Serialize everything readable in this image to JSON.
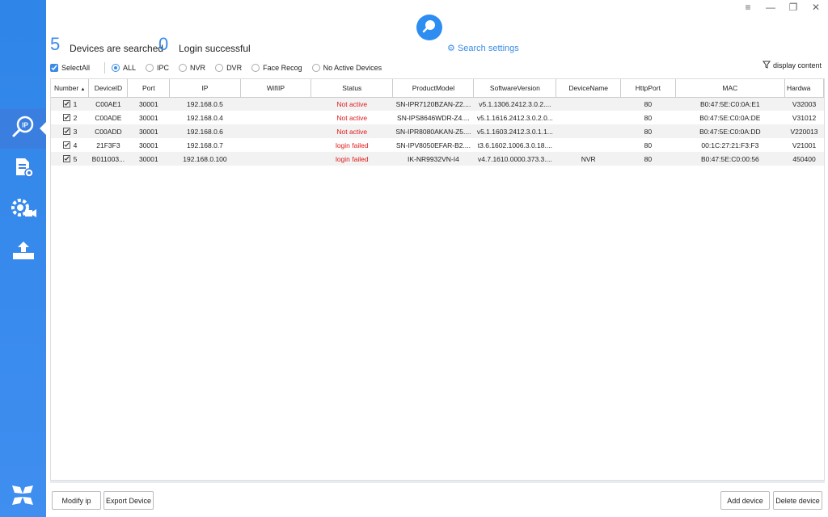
{
  "window": {
    "menu": "≡",
    "minimize": "—",
    "restore": "❐",
    "close": "✕"
  },
  "stats": {
    "searched_count": "5",
    "searched_label": "Devices are searched",
    "login_count": "0",
    "login_label": "Login successful"
  },
  "search": {
    "settings_label": "Search settings"
  },
  "filters": {
    "select_all": "SelectAll",
    "options": [
      "ALL",
      "IPC",
      "NVR",
      "DVR",
      "Face Recog",
      "No Active Devices"
    ],
    "selected": "ALL",
    "display_content": "display content"
  },
  "table": {
    "columns": [
      "Number",
      "DeviceID",
      "Port",
      "IP",
      "WifiIP",
      "Status",
      "ProductModel",
      "SoftwareVersion",
      "DeviceName",
      "HttpPort",
      "MAC",
      "Hardwa"
    ],
    "rows": [
      {
        "number": "1",
        "device_id": "C00AE1",
        "port": "30001",
        "ip": "192.168.0.5",
        "wifi_ip": "",
        "status": "Not active",
        "product_model": "SN-IPR7120BZAN-Z2....",
        "software_version": "v5.1.1306.2412.3.0.2....",
        "device_name": "",
        "http_port": "80",
        "mac": "B0:47:5E:C0:0A:E1",
        "hardware": "V32003"
      },
      {
        "number": "2",
        "device_id": "C00ADE",
        "port": "30001",
        "ip": "192.168.0.4",
        "wifi_ip": "",
        "status": "Not active",
        "product_model": "SN-IPS8646WDR-Z4....",
        "software_version": "v5.1.1616.2412.3.0.2.0...",
        "device_name": "",
        "http_port": "80",
        "mac": "B0:47:5E:C0:0A:DE",
        "hardware": "V31012"
      },
      {
        "number": "3",
        "device_id": "C00ADD",
        "port": "30001",
        "ip": "192.168.0.6",
        "wifi_ip": "",
        "status": "Not active",
        "product_model": "SN-IPR8080AKAN-Z5....",
        "software_version": "v5.1.1603.2412.3.0.1.1...",
        "device_name": "",
        "http_port": "80",
        "mac": "B0:47:5E:C0:0A:DD",
        "hardware": "V220013"
      },
      {
        "number": "4",
        "device_id": "21F3F3",
        "port": "30001",
        "ip": "192.168.0.7",
        "wifi_ip": "",
        "status": "login failed",
        "product_model": "SN-IPV8050EFAR-B2....",
        "software_version": "t3.6.1602.1006.3.0.18....",
        "device_name": "",
        "http_port": "80",
        "mac": "00:1C:27:21:F3:F3",
        "hardware": "V21001"
      },
      {
        "number": "5",
        "device_id": "B011003...",
        "port": "30001",
        "ip": "192.168.0.100",
        "wifi_ip": "",
        "status": "login failed",
        "product_model": "IK-NR9932VN-I4",
        "software_version": "v4.7.1610.0000.373.3....",
        "device_name": "NVR",
        "http_port": "80",
        "mac": "B0:47:5E:C0:00:56",
        "hardware": "450400"
      }
    ]
  },
  "buttons": {
    "modify_ip": "Modify ip",
    "export_device": "Export Device",
    "add_device": "Add device",
    "delete_device": "Delete device"
  },
  "colors": {
    "accent": "#3b8ce8",
    "sidebar": "#2f86e8",
    "error": "#e01a1a"
  }
}
